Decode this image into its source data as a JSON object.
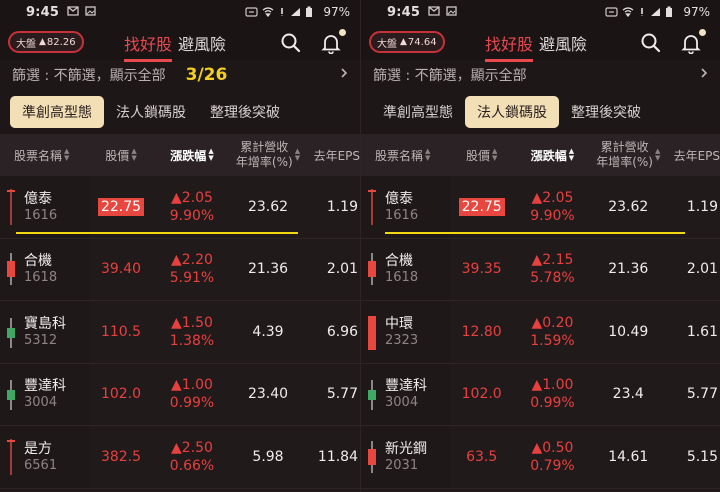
{
  "panels": [
    {
      "status": {
        "time": "9:45",
        "battery": "97%"
      },
      "market": {
        "label": "大盤",
        "value": "82.26"
      },
      "top_tabs": [
        "找好股",
        "避風險"
      ],
      "filter": {
        "text": "篩選 : 不篩選，顯示全部",
        "date": "3/26"
      },
      "sub_tabs": [
        "準創高型態",
        "法人鎖碼股",
        "整理後突破"
      ],
      "active_sub_tab": 0,
      "headers": {
        "name": "股票名稱",
        "price": "股價",
        "change": "漲跌幅",
        "growth_1": "累計營收",
        "growth_2": "年增率(%)",
        "eps": "去年EPS"
      },
      "rows": [
        {
          "name": "億泰",
          "code": "1616",
          "price": "22.75",
          "change": "▲2.05",
          "pct": "9.90%",
          "growth": "23.62",
          "eps": "1.19",
          "candle": "flat",
          "highlight": true
        },
        {
          "name": "合機",
          "code": "1618",
          "price": "39.40",
          "change": "▲2.20",
          "pct": "5.91%",
          "growth": "21.36",
          "eps": "2.01",
          "candle": "red"
        },
        {
          "name": "寶島科",
          "code": "5312",
          "price": "110.5",
          "change": "▲1.50",
          "pct": "1.38%",
          "growth": "4.39",
          "eps": "6.96",
          "candle": "green"
        },
        {
          "name": "豐達科",
          "code": "3004",
          "price": "102.0",
          "change": "▲1.00",
          "pct": "0.99%",
          "growth": "23.40",
          "eps": "5.77",
          "candle": "green"
        },
        {
          "name": "是方",
          "code": "6561",
          "price": "382.5",
          "change": "▲2.50",
          "pct": "0.66%",
          "growth": "5.98",
          "eps": "11.84",
          "candle": "flat"
        }
      ]
    },
    {
      "status": {
        "time": "9:45",
        "battery": "97%"
      },
      "market": {
        "label": "大盤",
        "value": "74.64"
      },
      "top_tabs": [
        "找好股",
        "避風險"
      ],
      "filter": {
        "text": "篩選 : 不篩選，顯示全部",
        "date": ""
      },
      "sub_tabs": [
        "準創高型態",
        "法人鎖碼股",
        "整理後突破"
      ],
      "active_sub_tab": 1,
      "headers": {
        "name": "股票名稱",
        "price": "股價",
        "change": "漲跌幅",
        "growth_1": "累計營收",
        "growth_2": "年增率(%)",
        "eps": "去年EPS"
      },
      "rows": [
        {
          "name": "億泰",
          "code": "1616",
          "price": "22.75",
          "change": "▲2.05",
          "pct": "9.90%",
          "growth": "23.62",
          "eps": "1.19",
          "candle": "flat",
          "highlight": true
        },
        {
          "name": "合機",
          "code": "1618",
          "price": "39.35",
          "change": "▲2.15",
          "pct": "5.78%",
          "growth": "21.36",
          "eps": "2.01",
          "candle": "red"
        },
        {
          "name": "中環",
          "code": "2323",
          "price": "12.80",
          "change": "▲0.20",
          "pct": "1.59%",
          "growth": "10.49",
          "eps": "1.61",
          "candle": "redtall"
        },
        {
          "name": "豐達科",
          "code": "3004",
          "price": "102.0",
          "change": "▲1.00",
          "pct": "0.99%",
          "growth": "23.4",
          "eps": "5.77",
          "candle": "green"
        },
        {
          "name": "新光鋼",
          "code": "2031",
          "price": "63.5",
          "change": "▲0.50",
          "pct": "0.79%",
          "growth": "14.61",
          "eps": "5.15",
          "candle": "red"
        }
      ]
    }
  ]
}
